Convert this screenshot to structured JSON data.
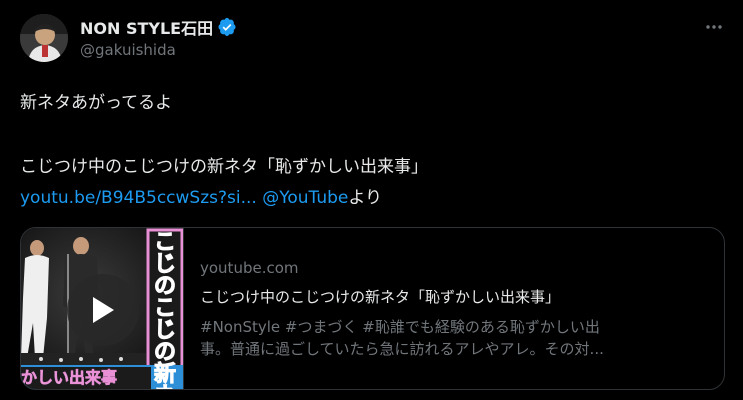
{
  "author": {
    "display_name": "NON STYLE石田",
    "handle": "@gakuishida"
  },
  "tweet": {
    "line1": "新ネタあがってるよ",
    "line2": "こじつけ中のこじつけの新ネタ「恥ずかしい出来事」",
    "link_url": "youtu.be/B94B5ccwSzs?si...",
    "mention": "@YouTube",
    "suffix": "より"
  },
  "card": {
    "domain": "youtube.com",
    "title": "こじつけ中のこじつけの新ネタ「恥ずかしい出来事」",
    "desc_line1": "#NonStyle #つまづく #恥誰でも経験のある恥ずかしい出",
    "desc_line2": "事。普通に過ごしていたら急に訪れるアレやアレ。その対...",
    "thumb_vertical_text": "こじのこじの新ネ",
    "thumb_caption": "かしい出来事"
  },
  "colors": {
    "accent": "#1d9bf0",
    "background": "#000000",
    "text": "#e7e9ea",
    "muted": "#71767b",
    "thumb_pink": "#e88fd6"
  },
  "icons": {
    "verified": "verified-badge-icon",
    "more": "more-horizontal-icon",
    "play": "play-icon"
  }
}
